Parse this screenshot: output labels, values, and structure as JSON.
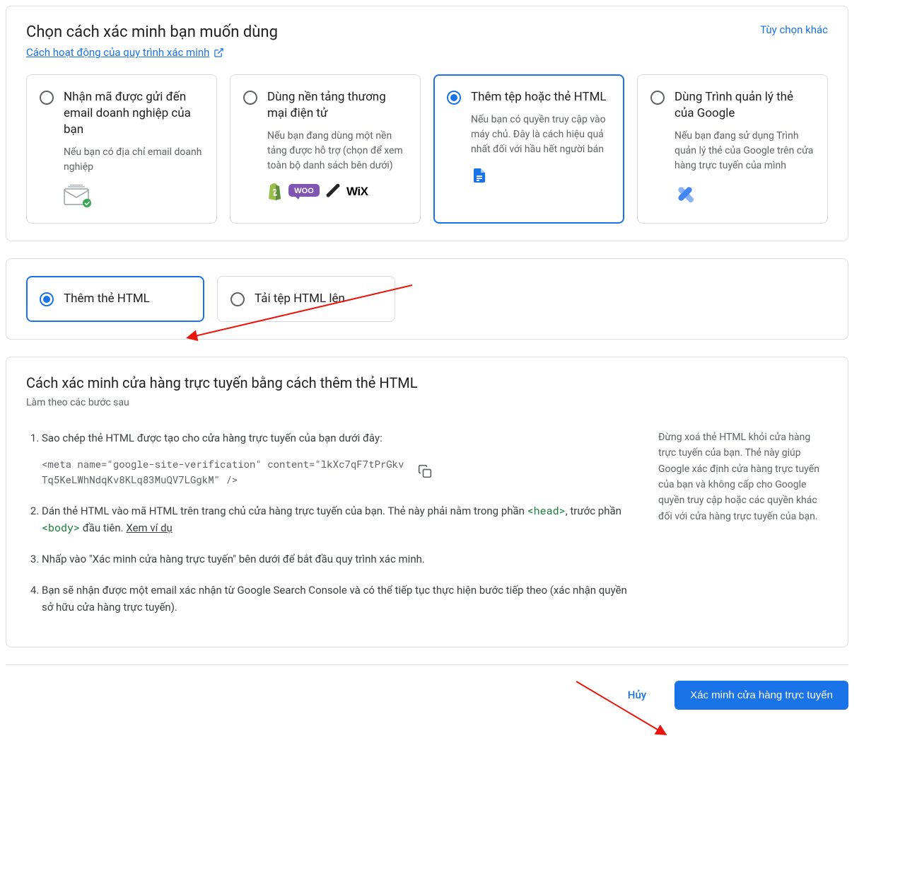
{
  "header": {
    "title": "Chọn cách xác minh bạn muốn dùng",
    "how_link": "Cách hoạt động của quy trình xác minh",
    "other_options": "Tùy chọn khác"
  },
  "options": [
    {
      "title": "Nhận mã được gửi đến email doanh nghiệp của bạn",
      "desc": "Nếu bạn có địa chỉ email doanh nghiệp"
    },
    {
      "title": "Dùng nền tảng thương mại điện tử",
      "desc": "Nếu bạn đang dùng một nền tảng được hỗ trợ (chọn để xem toàn bộ danh sách bên dưới)"
    },
    {
      "title": "Thêm tệp hoặc thẻ HTML",
      "desc": "Nếu bạn có quyền truy cập vào máy chủ. Đây là cách hiệu quả nhất đối với hầu hết người bán"
    },
    {
      "title": "Dùng Trình quản lý thẻ của Google",
      "desc": "Nếu bạn đang sử dụng Trình quản lý thẻ của Google trên cửa hàng trực tuyến của mình"
    }
  ],
  "sub_options": [
    {
      "title": "Thêm thẻ HTML"
    },
    {
      "title": "Tải tệp HTML lên"
    }
  ],
  "instructions": {
    "title": "Cách xác minh cửa hàng trực tuyến bằng cách thêm thẻ HTML",
    "sub": "Làm theo các bước sau",
    "steps": {
      "s1": "Sao chép thẻ HTML được tạo cho cửa hàng trực tuyến của bạn dưới đây:",
      "code": "<meta name=\"google-site-verification\" content=\"lkXc7qF7tPrGkvTq5KeLWhNdqKv8KLq83MuQV7LGgkM\"  />",
      "s2_a": "Dán thẻ HTML vào mã HTML trên trang chủ cửa hàng trực tuyến của bạn. Thẻ này phải nằm trong phần ",
      "s2_head": "<head>",
      "s2_b": ", trước phần ",
      "s2_body": "<body>",
      "s2_c": " đầu tiên. ",
      "s2_link": "Xem ví dụ",
      "s3": "Nhấp vào \"Xác minh cửa hàng trực tuyến\" bên dưới để bắt đầu quy trình xác minh.",
      "s4": "Bạn sẽ nhận được một email xác nhận từ Google Search Console và có thể tiếp tục thực hiện bước tiếp theo (xác nhận quyền sở hữu cửa hàng trực tuyến)."
    },
    "note": "Đừng xoá thẻ HTML khỏi cửa hàng trực tuyến của bạn. Thẻ này giúp Google xác định cửa hàng trực tuyến của bạn và không cấp cho Google quyền truy cập hoặc các quyền khác đối với cửa hàng trực tuyến của bạn."
  },
  "footer": {
    "cancel": "Hủy",
    "verify": "Xác minh cửa hàng trực tuyến"
  },
  "platforms_wix": "WiX"
}
